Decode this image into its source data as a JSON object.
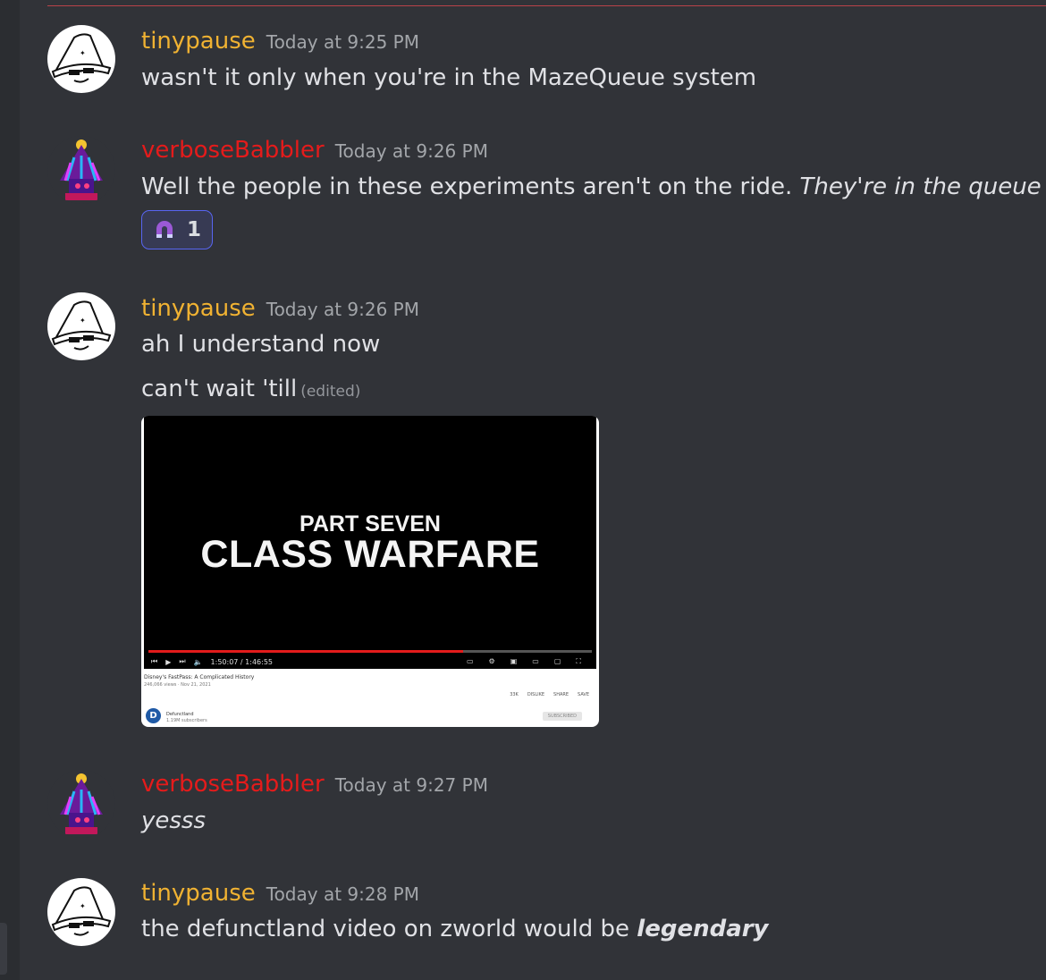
{
  "colors": {
    "background": "#313338",
    "tinypause_name": "#f0b232",
    "verbose_name": "#e51b1b",
    "reaction_border": "#5865f2",
    "new_messages_divider": "#b84349"
  },
  "messages": [
    {
      "author": "tinypause",
      "time": "Today at 9:25 PM",
      "text": "wasn't it only when you're in the MazeQueue system"
    },
    {
      "author": "verboseBabbler",
      "time": "Today at 9:26 PM",
      "text_plain": "Well the people in these experiments aren't on the ride. ",
      "text_italic": "They're in the queue",
      "reaction": {
        "icon": "magnet-emoji",
        "count": "1"
      }
    },
    {
      "author": "tinypause",
      "time": "Today at 9:26 PM",
      "line1": "ah I understand now",
      "line2": "can't wait 'till",
      "edited": "(edited)",
      "embed": {
        "part": "PART SEVEN",
        "title": "CLASS WARFARE",
        "progress": 0.71,
        "time_readout": "1:50:07 / 1:46:55",
        "video_title": "Disney's FastPass: A Complicated History",
        "views": "246,066 views · Nov 21, 2021",
        "actions": [
          "33K",
          "DISLIKE",
          "SHARE",
          "SAVE"
        ],
        "channel": "Defunctland",
        "channel_initial": "D",
        "subscribers": "1.19M subscribers",
        "subscribe": "SUBSCRIBED"
      }
    },
    {
      "author": "verboseBabbler",
      "time": "Today at 9:27 PM",
      "text": "yesss"
    },
    {
      "author": "tinypause",
      "time": "Today at 9:28 PM",
      "text_plain": "the defunctland video on zworld would be ",
      "text_bold_italic": "legendary"
    }
  ]
}
